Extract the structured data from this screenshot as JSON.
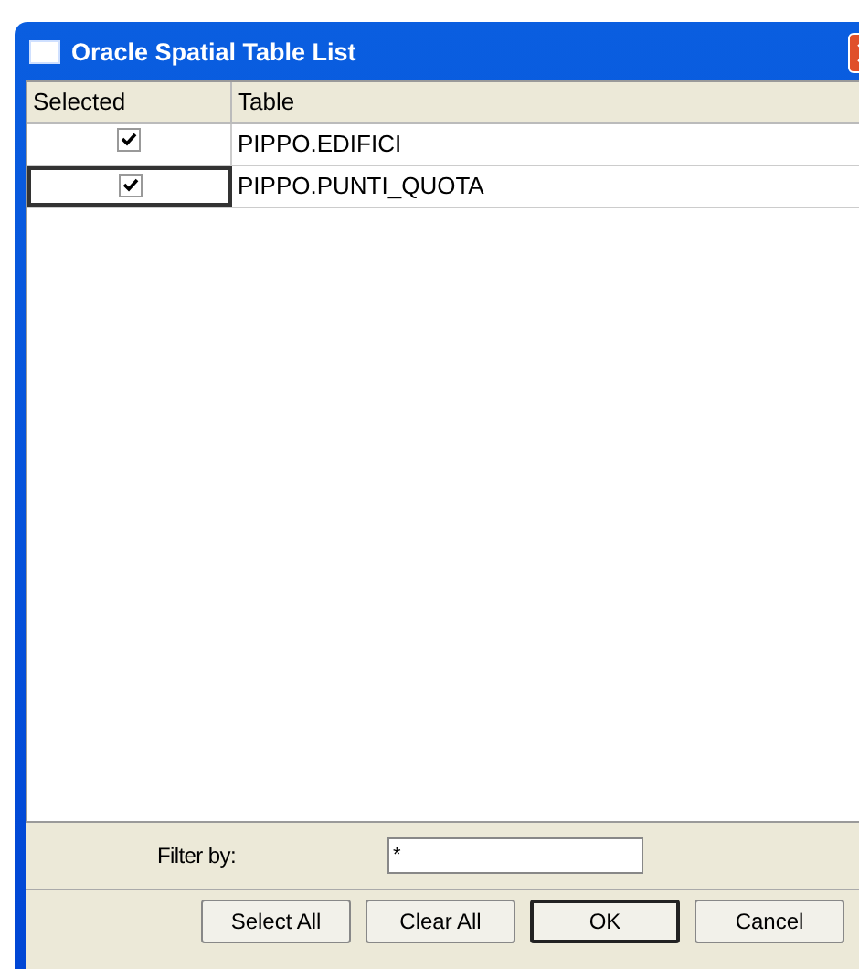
{
  "window": {
    "title": "Oracle Spatial Table List"
  },
  "table": {
    "columns": [
      "Selected",
      "Table"
    ],
    "rows": [
      {
        "checked": true,
        "focused": false,
        "table": "PIPPO.EDIFICI"
      },
      {
        "checked": true,
        "focused": true,
        "table": "PIPPO.PUNTI_QUOTA"
      }
    ]
  },
  "filter": {
    "label": "Filter by:",
    "value": "*"
  },
  "buttons": [
    {
      "label": "Select All",
      "default": false
    },
    {
      "label": "Clear All",
      "default": false
    },
    {
      "label": "OK",
      "default": true
    },
    {
      "label": "Cancel",
      "default": false
    }
  ]
}
